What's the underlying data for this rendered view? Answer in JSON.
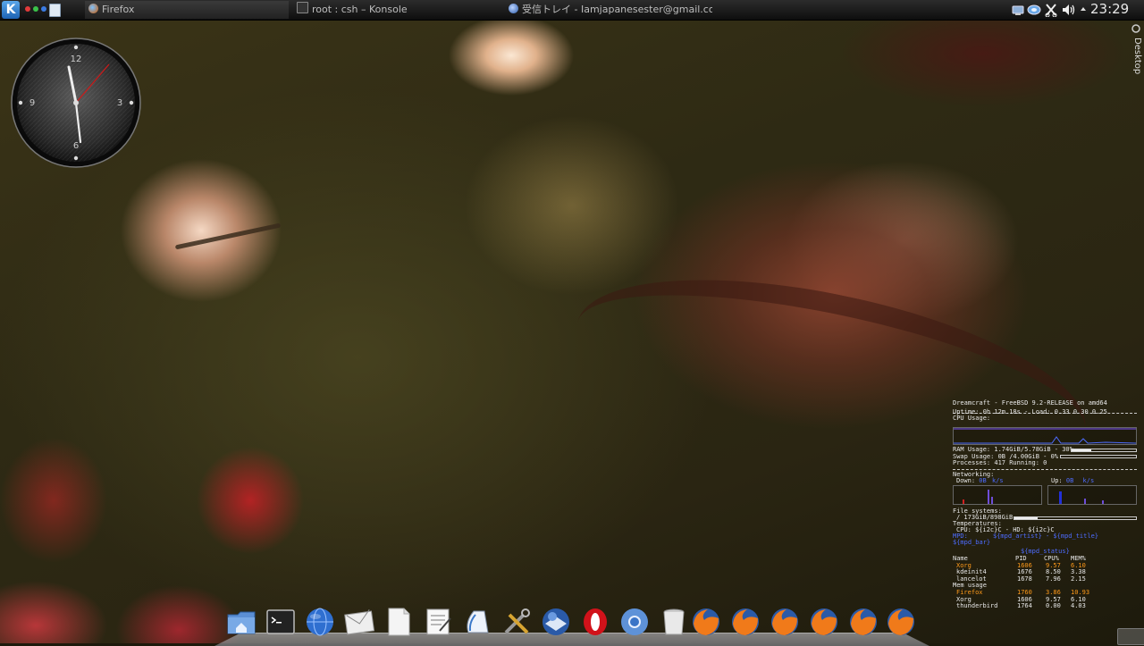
{
  "panel": {
    "tasks": [
      {
        "label": "Firefox",
        "icon": "firefox-icon"
      },
      {
        "label": "root : csh – Konsole",
        "icon": "terminal-icon"
      },
      {
        "label": "受信トレイ - Iamjapanesester@gmail.com - Moz",
        "icon": "thunderbird-icon"
      }
    ],
    "clock": "23:29",
    "tray_icons": [
      "network-icon",
      "wifi-icon",
      "klipper-icon",
      "volume-icon",
      "panel-menu-arrow-icon"
    ]
  },
  "side_widget": {
    "label": "Desktop"
  },
  "clock_widget": {
    "marks": [
      "12",
      "3",
      "6",
      "9"
    ]
  },
  "conky": {
    "header": "Dreamcraft - FreeBSD 9.2-RELEASE on amd64",
    "uptime": "Uptime: 0h 12m 18s - Load: 0.33 0.30 0.25",
    "cpu_usage": "CPU Usage:",
    "ram_usage": "RAM Usage: 1.74GiB/5.78GiB - 30%",
    "ram_fraction": 0.3,
    "swap_usage": "Swap Usage: 0B  /4.00GiB - 0%",
    "swap_fraction": 0.0,
    "processes": "Processes: 417  Running: 0",
    "networking": "Networking:",
    "down_label": "Down:",
    "down_value": "0B",
    "down_unit": "k/s",
    "up_label": "Up:",
    "up_value": "0B",
    "up_unit": "k/s",
    "file_systems": "File systems:",
    "fs_root": "/ 173GiB/898GiB",
    "fs_fraction": 0.19,
    "temperatures": "Temperatures:",
    "temps_line": "CPU: ${i2c}C - HD: ${i2c}C",
    "mpd_label": "MPD:",
    "mpd_line": "${mpd_artist} - ${mpd_title}",
    "mpd_bar": "${mpd_bar}",
    "mpd_status": "${mpd_status}",
    "cpu_table": {
      "headers": [
        "Name",
        "PID",
        "CPU%",
        "MEM%"
      ],
      "rows": [
        [
          "Xorg",
          "1606",
          "9.57",
          "6.10"
        ],
        [
          "kdeinit4",
          "1676",
          "8.50",
          "3.38"
        ],
        [
          "lancelot",
          "1678",
          "7.96",
          "2.15"
        ]
      ]
    },
    "mem_title": "Mem usage",
    "mem_table": {
      "rows": [
        [
          "Firefox",
          "1760",
          "3.86",
          "10.93"
        ],
        [
          "Xorg",
          "1606",
          "9.57",
          "6.10"
        ],
        [
          "thunderbird",
          "1764",
          "0.00",
          "4.03"
        ]
      ]
    }
  },
  "dock": {
    "icons": [
      "home-folder-icon",
      "terminal-icon",
      "globe-icon",
      "mail-icon",
      "document-icon",
      "text-editor-icon",
      "file-manager-icon",
      "tools-icon",
      "thunderbird-icon",
      "opera-icon",
      "chromium-icon",
      "trash-icon",
      "firefox-icon",
      "firefox-icon",
      "firefox-icon",
      "firefox-icon",
      "firefox-icon",
      "firefox-icon"
    ]
  },
  "colors": {
    "panel": "#111111",
    "conky_text": "#e8e8e8",
    "conky_accent": "#4d6cff",
    "conky_highlight": "#ff9a1a"
  }
}
